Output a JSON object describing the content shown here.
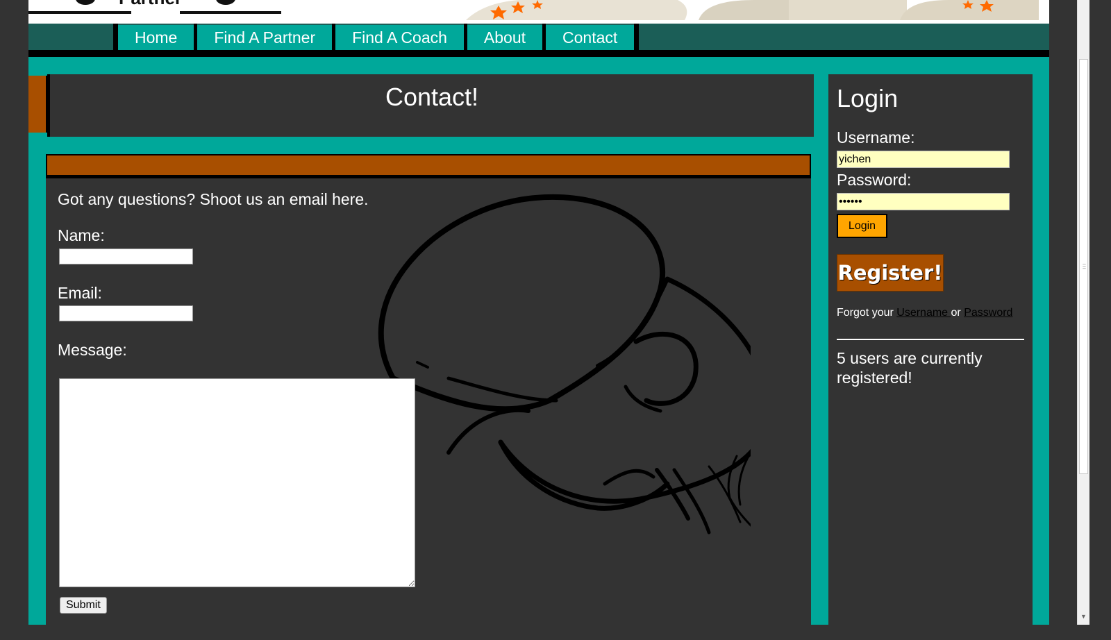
{
  "nav": {
    "items": [
      "Home",
      "Find A Partner",
      "Find A Coach",
      "About",
      "Contact"
    ]
  },
  "header": {
    "logo_text": "Partner"
  },
  "main": {
    "title": "Contact!",
    "intro": "Got any questions? Shoot us an email here.",
    "name_label": "Name:",
    "email_label": "Email:",
    "message_label": "Message:",
    "submit_label": "Submit"
  },
  "sidebar": {
    "title": "Login",
    "username_label": "Username:",
    "username_value": "yichen",
    "password_label": "Password:",
    "password_value": "••••••",
    "login_label": "Login",
    "register_label": "Register!",
    "forgot_prefix": "Forgot your ",
    "forgot_username": "Username ",
    "forgot_or": " or ",
    "forgot_password": "Password",
    "users_text": "5 users are currently registered!"
  },
  "colors": {
    "teal": "#00a89a",
    "dark_teal": "#1b5e57",
    "panel": "#333333",
    "rust": "#a84f00",
    "orange": "#ffa500",
    "input_yellow": "#ffffc0"
  }
}
